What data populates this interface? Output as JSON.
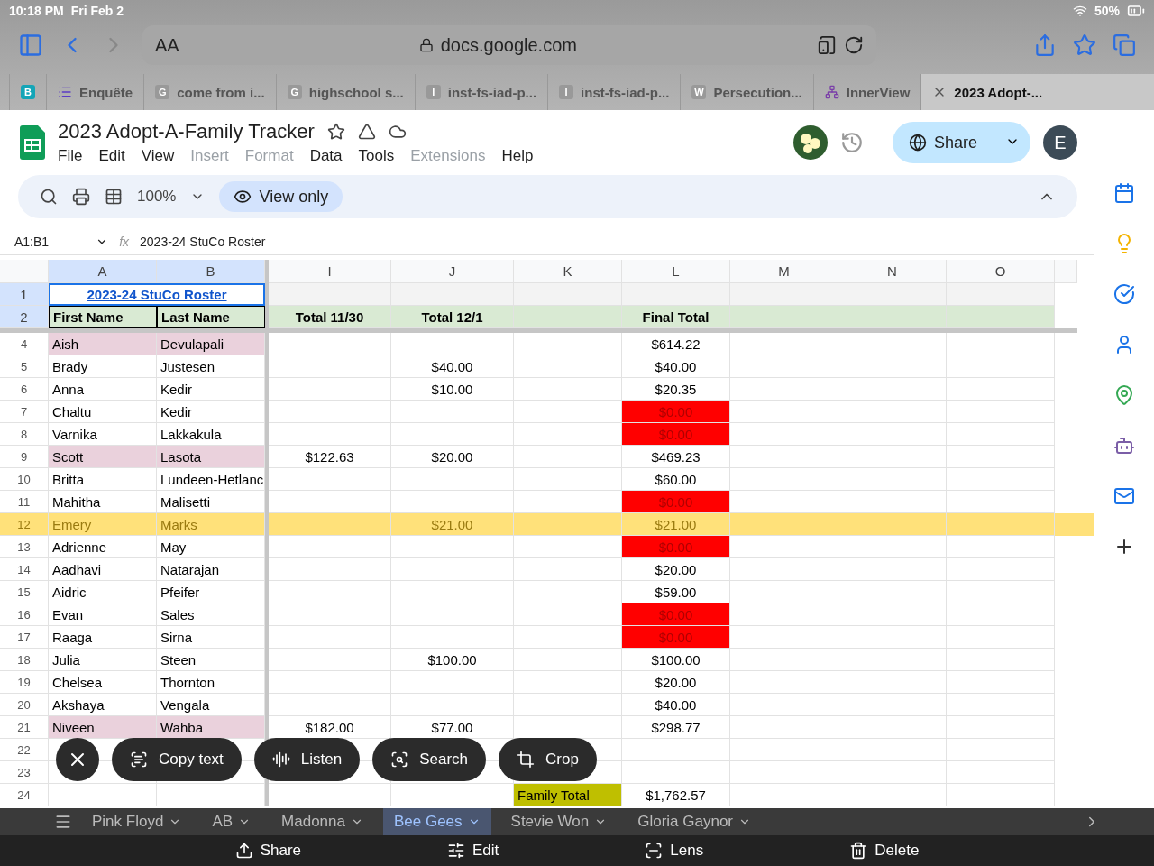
{
  "status_bar": {
    "time": "10:18 PM",
    "date": "Fri Feb 2",
    "battery": "50%"
  },
  "browser": {
    "font_size_label": "AA",
    "url": "docs.google.com",
    "tabs": [
      {
        "kind": "badge",
        "badge": "B",
        "selected": false
      },
      {
        "kind": "list",
        "label": "Enquête",
        "selected": false
      },
      {
        "kind": "letter",
        "label": "come from i...",
        "letter": "G",
        "selected": false
      },
      {
        "kind": "letter",
        "label": "highschool s...",
        "letter": "G",
        "selected": false
      },
      {
        "kind": "letter",
        "label": "inst-fs-iad-p...",
        "letter": "I",
        "selected": false
      },
      {
        "kind": "letter",
        "label": "inst-fs-iad-p...",
        "letter": "I",
        "selected": false
      },
      {
        "kind": "letter",
        "label": "Persecution...",
        "letter": "W",
        "selected": false
      },
      {
        "kind": "nodes",
        "label": "InnerView",
        "selected": false
      },
      {
        "kind": "close",
        "label": "2023 Adopt-...",
        "selected": true
      }
    ]
  },
  "doc": {
    "title": "2023 Adopt-A-Family Tracker",
    "share_label": "Share",
    "avatar_letter": "E",
    "menu": [
      {
        "label": "File",
        "disabled": false
      },
      {
        "label": "Edit",
        "disabled": false
      },
      {
        "label": "View",
        "disabled": false
      },
      {
        "label": "Insert",
        "disabled": true
      },
      {
        "label": "Format",
        "disabled": true
      },
      {
        "label": "Data",
        "disabled": false
      },
      {
        "label": "Tools",
        "disabled": false
      },
      {
        "label": "Extensions",
        "disabled": true
      },
      {
        "label": "Help",
        "disabled": false
      }
    ],
    "zoom": "100%",
    "view_mode": "View only"
  },
  "formula_bar": {
    "range": "A1:B1",
    "fx": "fx",
    "content": "2023-24 StuCo Roster"
  },
  "sheet": {
    "columns": [
      "A",
      "B",
      "I",
      "J",
      "K",
      "L",
      "M",
      "N",
      "O"
    ],
    "title_row": {
      "num": "1",
      "text": "2023-24 StuCo Roster"
    },
    "header_row": {
      "num": "2",
      "a": "First Name",
      "b": "Last Name",
      "i": "Total 11/30",
      "j": "Total 12/1",
      "l": "Final Total"
    },
    "rows": [
      {
        "num": "4",
        "a": "Aish",
        "b": "Devulapali",
        "l": "$614.22",
        "flagged": true,
        "alert": false,
        "highlighted": false
      },
      {
        "num": "5",
        "a": "Brady",
        "b": "Justesen",
        "j": "$40.00",
        "l": "$40.00",
        "flagged": false,
        "alert": false,
        "highlighted": false
      },
      {
        "num": "6",
        "a": "Anna",
        "b": "Kedir",
        "j": "$10.00",
        "l": "$20.35",
        "flagged": false,
        "alert": false,
        "highlighted": false
      },
      {
        "num": "7",
        "a": "Chaltu",
        "b": "Kedir",
        "l": "$0.00",
        "flagged": false,
        "alert": true,
        "highlighted": false
      },
      {
        "num": "8",
        "a": "Varnika",
        "b": "Lakkakula",
        "l": "$0.00",
        "flagged": false,
        "alert": true,
        "highlighted": false
      },
      {
        "num": "9",
        "a": "Scott",
        "b": "Lasota",
        "i": "$122.63",
        "j": "$20.00",
        "l": "$469.23",
        "flagged": true,
        "alert": false,
        "highlighted": false
      },
      {
        "num": "10",
        "a": "Britta",
        "b": "Lundeen-Hetlanc",
        "l": "$60.00",
        "flagged": false,
        "alert": false,
        "highlighted": false
      },
      {
        "num": "11",
        "a": "Mahitha",
        "b": "Malisetti",
        "l": "$0.00",
        "flagged": false,
        "alert": true,
        "highlighted": false
      },
      {
        "num": "12",
        "a": "Emery",
        "b": "Marks",
        "j": "$21.00",
        "l": "$21.00",
        "flagged": false,
        "alert": false,
        "highlighted": true
      },
      {
        "num": "13",
        "a": "Adrienne",
        "b": "May",
        "l": "$0.00",
        "flagged": false,
        "alert": true,
        "highlighted": false
      },
      {
        "num": "14",
        "a": "Aadhavi",
        "b": "Natarajan",
        "l": "$20.00",
        "flagged": false,
        "alert": false,
        "highlighted": false
      },
      {
        "num": "15",
        "a": "Aidric",
        "b": "Pfeifer",
        "l": "$59.00",
        "flagged": false,
        "alert": false,
        "highlighted": false
      },
      {
        "num": "16",
        "a": "Evan",
        "b": "Sales",
        "l": "$0.00",
        "flagged": false,
        "alert": true,
        "highlighted": false
      },
      {
        "num": "17",
        "a": "Raaga",
        "b": "Sirna",
        "l": "$0.00",
        "flagged": false,
        "alert": true,
        "highlighted": false
      },
      {
        "num": "18",
        "a": "Julia",
        "b": "Steen",
        "j": "$100.00",
        "l": "$100.00",
        "flagged": false,
        "alert": false,
        "highlighted": false
      },
      {
        "num": "19",
        "a": "Chelsea",
        "b": "Thornton",
        "l": "$20.00",
        "flagged": false,
        "alert": false,
        "highlighted": false
      },
      {
        "num": "20",
        "a": "Akshaya",
        "b": "Vengala",
        "l": "$40.00",
        "flagged": false,
        "alert": false,
        "highlighted": false
      },
      {
        "num": "21",
        "a": "Niveen",
        "b": "Wahba",
        "i": "$182.00",
        "j": "$77.00",
        "l": "$298.77",
        "flagged": true,
        "alert": false,
        "highlighted": false
      },
      {
        "num": "22",
        "flagged": false,
        "alert": false,
        "highlighted": false
      },
      {
        "num": "23",
        "flagged": false,
        "alert": false,
        "highlighted": false
      },
      {
        "num": "24",
        "k": "Family Total",
        "l": "$1,762.57",
        "flagged": false,
        "alert": false,
        "highlighted": false,
        "kind": "total"
      }
    ],
    "sheet_tabs": [
      {
        "label": "Pink Floyd",
        "selected": false
      },
      {
        "label": "AB",
        "selected": false
      },
      {
        "label": "Madonna",
        "selected": false
      },
      {
        "label": "Bee Gees",
        "selected": true
      },
      {
        "label": "Stevie Won",
        "selected": false
      },
      {
        "label": "Gloria Gaynor",
        "selected": false
      }
    ]
  },
  "lens_chips": [
    {
      "kind": "close"
    },
    {
      "kind": "copy",
      "label": "Copy text"
    },
    {
      "kind": "listen",
      "label": "Listen"
    },
    {
      "kind": "search",
      "label": "Search"
    },
    {
      "kind": "crop",
      "label": "Crop"
    }
  ],
  "actions": [
    {
      "kind": "share",
      "label": "Share"
    },
    {
      "kind": "edit",
      "label": "Edit"
    },
    {
      "kind": "lens",
      "label": "Lens"
    },
    {
      "kind": "delete",
      "label": "Delete"
    }
  ]
}
